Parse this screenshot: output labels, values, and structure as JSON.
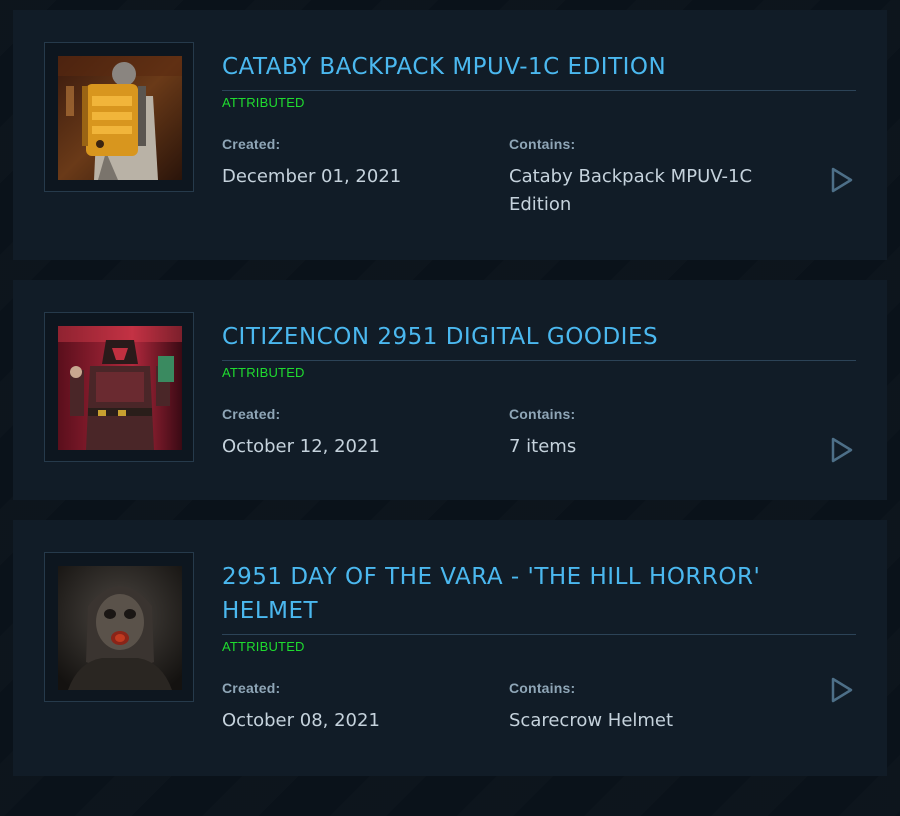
{
  "pledges": [
    {
      "title": "CATABY BACKPACK MPUV-1C EDITION",
      "status": "ATTRIBUTED",
      "created_label": "Created:",
      "created_value": "December 01, 2021",
      "contains_label": "Contains:",
      "contains_value": "Cataby Backpack MPUV-1C Edition",
      "image": "backpack-thumbnail",
      "action_icon": "play-triangle-icon"
    },
    {
      "title": "CITIZENCON 2951 DIGITAL GOODIES",
      "status": "ATTRIBUTED",
      "created_label": "Created:",
      "created_value": "October 12, 2021",
      "contains_label": "Contains:",
      "contains_value": "7 items",
      "image": "armored-character-thumbnail",
      "action_icon": "play-triangle-icon"
    },
    {
      "title": "2951 DAY OF THE VARA - 'THE HILL HORROR' HELMET",
      "status": "ATTRIBUTED",
      "created_label": "Created:",
      "created_value": "October 08, 2021",
      "contains_label": "Contains:",
      "contains_value": "Scarecrow Helmet",
      "image": "helmet-thumbnail",
      "action_icon": "play-triangle-icon"
    }
  ],
  "colors": {
    "title": "#4bb8ef",
    "status": "#1fdc2f",
    "card_bg": "#111c27",
    "page_bg": "#0a121a"
  }
}
